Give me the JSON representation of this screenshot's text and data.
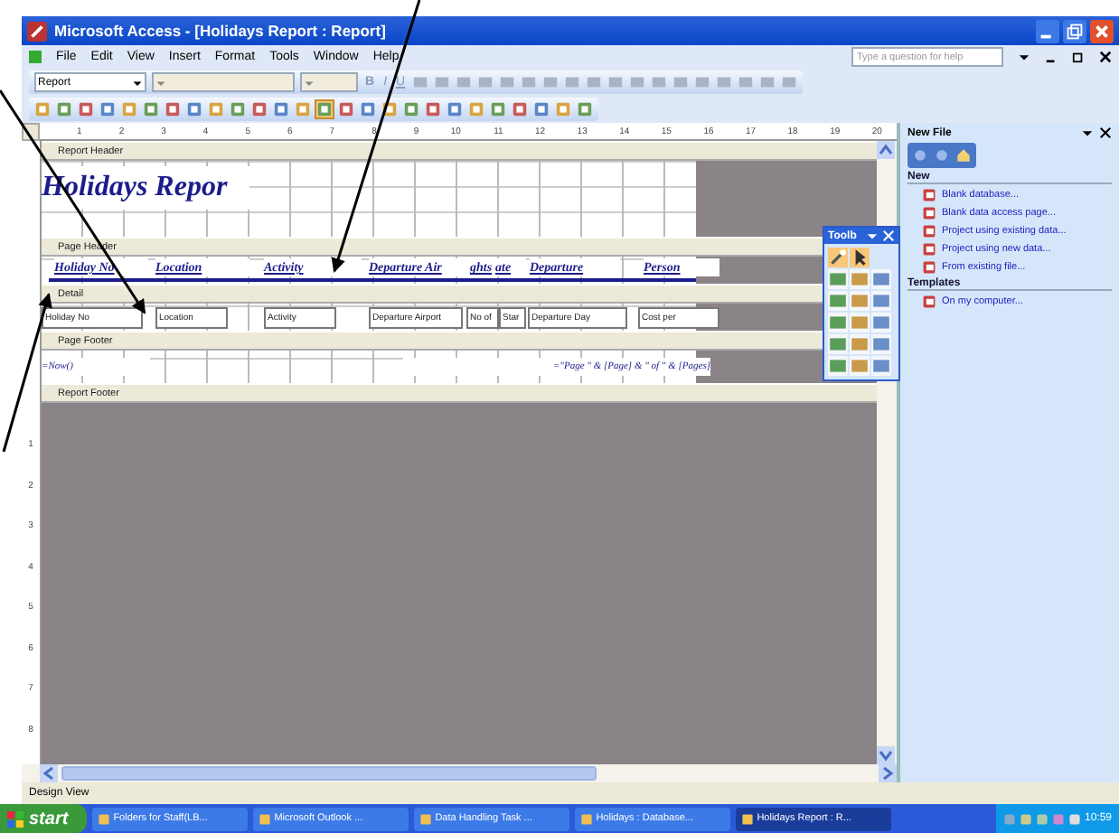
{
  "window": {
    "title": "Microsoft Access - [Holidays Report : Report]"
  },
  "menu": [
    "File",
    "Edit",
    "View",
    "Insert",
    "Format",
    "Tools",
    "Window",
    "Help"
  ],
  "help_box": {
    "placeholder": "Type a question for help"
  },
  "formatting_toolbar": {
    "object_box": "Report",
    "font_buttons": [
      "B",
      "I",
      "U"
    ]
  },
  "ruler": {
    "horizontal": [
      "1",
      "2",
      "3",
      "4",
      "5",
      "6",
      "7",
      "8",
      "9",
      "10",
      "11",
      "12",
      "13",
      "14",
      "15",
      "16",
      "17",
      "18",
      "19",
      "20"
    ],
    "vertical": [
      "1",
      "2",
      "3",
      "4",
      "5",
      "6",
      "7",
      "8"
    ]
  },
  "sections": [
    {
      "kind": "title",
      "bar": "Report Header",
      "controls": [
        {
          "text": "Holidays Repor"
        }
      ]
    },
    {
      "kind": "labels",
      "bar": "Page Header",
      "controls": [
        {
          "text": "Holiday No"
        },
        {
          "text": "Location"
        },
        {
          "text": "Activity"
        },
        {
          "text": "Departure Air"
        },
        {
          "text": "ghts"
        },
        {
          "text": "ate"
        },
        {
          "text": "Departure"
        },
        {
          "text": "Person"
        }
      ]
    },
    {
      "kind": "fields",
      "bar": "Detail",
      "controls": [
        {
          "text": "Holiday No"
        },
        {
          "text": "Location"
        },
        {
          "text": "Activity"
        },
        {
          "text": "Departure Airport"
        },
        {
          "text": "No of"
        },
        {
          "text": "Star"
        },
        {
          "text": "Departure Day"
        },
        {
          "text": "Cost per"
        }
      ]
    },
    {
      "kind": "footer",
      "bar": "Page Footer",
      "controls": [
        {
          "text": "=Now()"
        },
        {
          "text": "=\"Page \" & [Page] & \" of \" & [Pages]"
        }
      ]
    },
    {
      "kind": "empty",
      "bar": "Report Footer"
    }
  ],
  "toolbox": {
    "title": "Toolb"
  },
  "task_pane": {
    "title": "New File",
    "groups": [
      {
        "heading": "New",
        "links": [
          "Blank database...",
          "Blank data access page...",
          "Project using existing data...",
          "Project using new data...",
          "From existing file..."
        ]
      },
      {
        "heading": "Templates",
        "links": [
          "On my computer..."
        ]
      }
    ]
  },
  "status_bar": "Design View",
  "taskbar": {
    "start": "start",
    "items": [
      {
        "label": "Folders for Staff(LB...",
        "selected": false
      },
      {
        "label": "Microsoft Outlook ...",
        "selected": false
      },
      {
        "label": "Data Handling Task ...",
        "selected": false
      },
      {
        "label": "Holidays : Database...",
        "selected": false
      },
      {
        "label": "Holidays Report : R...",
        "selected": true
      }
    ],
    "clock": "10:59"
  }
}
